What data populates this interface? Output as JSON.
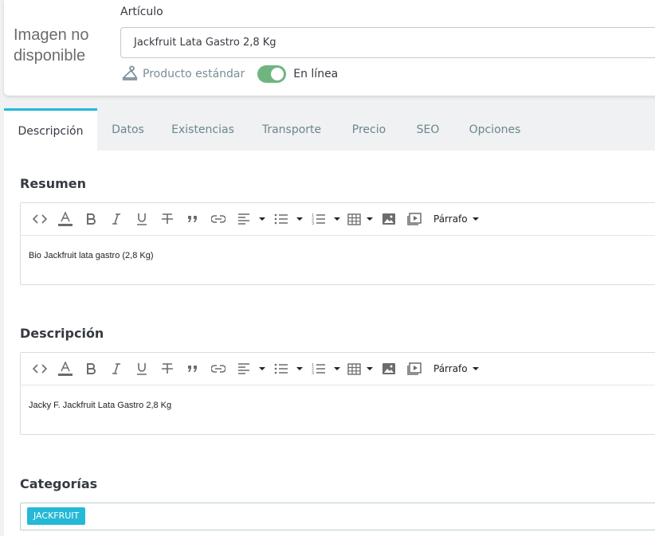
{
  "header": {
    "no_image_text": "Imagen no disponible",
    "name_label": "Artículo",
    "name_value": "Jackfruit Lata Gastro 2,8 Kg",
    "product_type": "Producto estándar",
    "online_label": "En línea",
    "online_enabled": true
  },
  "tabs": [
    {
      "label": "Descripción",
      "active": true
    },
    {
      "label": "Datos",
      "active": false
    },
    {
      "label": "Existencias",
      "active": false
    },
    {
      "label": "Transporte",
      "active": false
    },
    {
      "label": "Precio",
      "active": false
    },
    {
      "label": "SEO",
      "active": false
    },
    {
      "label": "Opciones",
      "active": false
    }
  ],
  "summary": {
    "title": "Resumen",
    "format": "Párrafo",
    "content": "Bio Jackfruit lata gastro (2,8 Kg)"
  },
  "description": {
    "title": "Descripción",
    "format": "Párrafo",
    "content": "Jacky F. Jackfruit Lata Gastro 2,8 Kg"
  },
  "categories": {
    "title": "Categorías",
    "tags": [
      "JACKFRUIT"
    ]
  },
  "colors": {
    "accent": "#25b9d7",
    "toggle_on": "#70b580"
  }
}
